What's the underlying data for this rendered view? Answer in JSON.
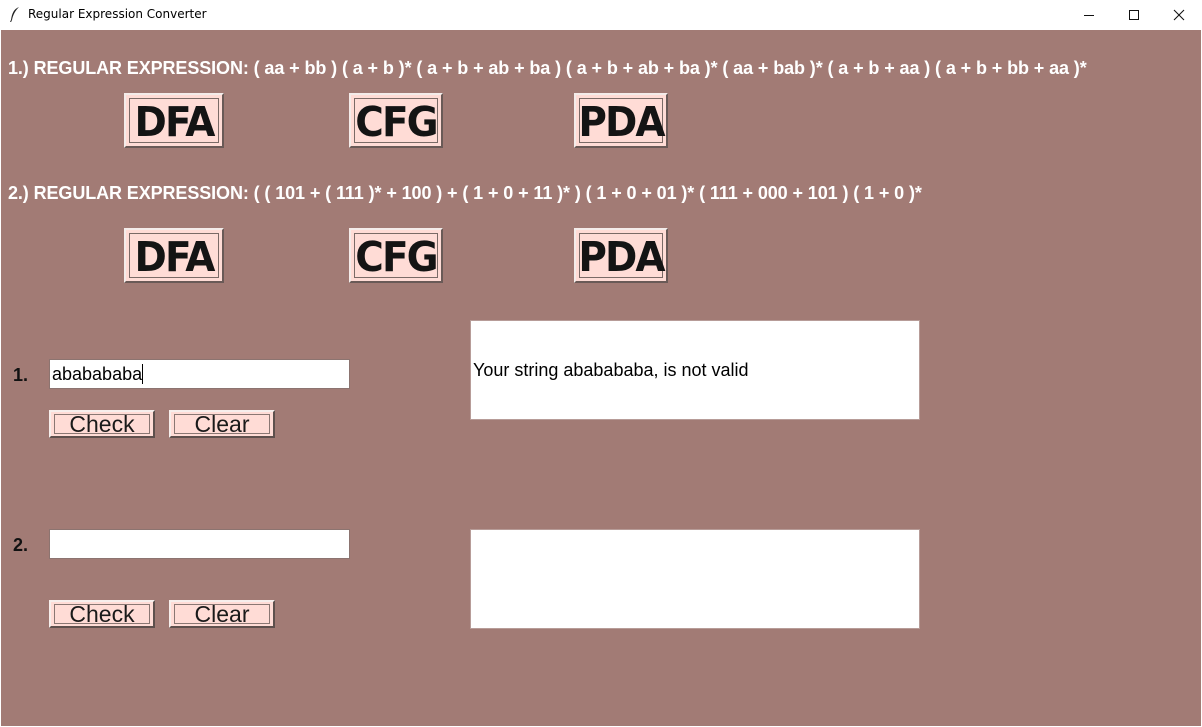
{
  "window": {
    "title": "Regular Expression Converter",
    "app_icon": "feather-icon",
    "controls": [
      "minimize-icon",
      "maximize-icon",
      "close-icon"
    ]
  },
  "colors": {
    "background": "#a27b75",
    "button_face": "#ffdcd6"
  },
  "regex1": {
    "label": "1.) REGULAR EXPRESSION: ( aa + bb ) ( a + b )* ( a + b + ab + ba ) ( a + b + ab + ba )* ( aa + bab )* ( a + b + aa ) ( a + b + bb + aa )*",
    "buttons": [
      "DFA",
      "CFG",
      "PDA"
    ]
  },
  "regex2": {
    "label": "2.) REGULAR EXPRESSION: ( ( 101 + ( 111 )* + 100 ) + ( 1 + 0 + 11 )* ) ( 1 + 0 + 01 )* ( 111 + 000 + 101 ) ( 1 + 0 )*",
    "buttons": [
      "DFA",
      "CFG",
      "PDA"
    ]
  },
  "checker1": {
    "number": "1.",
    "input_value": "ababababa",
    "check_label": "Check",
    "clear_label": "Clear",
    "result": "Your string ababababa, is not valid"
  },
  "checker2": {
    "number": "2.",
    "input_value": "",
    "check_label": "Check",
    "clear_label": "Clear",
    "result": ""
  }
}
